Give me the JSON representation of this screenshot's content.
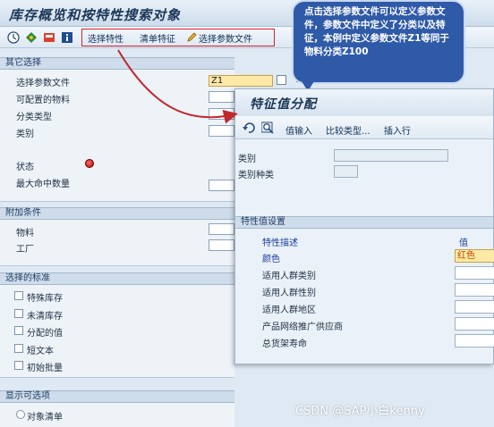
{
  "window": {
    "title": "库存概览和按特性搜索对象"
  },
  "toolbar": {
    "icons": [
      "execute-icon",
      "variant-icon",
      "save-variant-icon",
      "info-icon"
    ],
    "buttons": [
      "选择特性",
      "清单特征",
      "选择参数文件"
    ]
  },
  "callout": {
    "text": "点击选择参数文件可以定义参数文件，参数文件中定义了分类以及特征，本例中定义参数文件Z1等同于物料分类Z100"
  },
  "other_selection": {
    "header": "其它选择",
    "fields": [
      {
        "label": "选择参数文件",
        "value": "Z1",
        "suffix": "Z1"
      },
      {
        "label": "可配置的物料",
        "value": ""
      },
      {
        "label": "分类类型",
        "value": ""
      },
      {
        "label": "类别",
        "value": ""
      }
    ],
    "status_label": "状态",
    "max_hits_label": "最大命中数量"
  },
  "additional": {
    "header": "附加条件",
    "fields": [
      {
        "label": "物料"
      },
      {
        "label": "工厂"
      }
    ]
  },
  "criteria": {
    "header": "选择的标准",
    "checkboxes": [
      "特殊库存",
      "未清库存",
      "分配的值",
      "短文本",
      "初始批量"
    ]
  },
  "display": {
    "header": "显示可选项",
    "radios": [
      "对象清单"
    ]
  },
  "dialog": {
    "title": "特征值分配",
    "toolbar": [
      "值输入",
      "比较类型...",
      "插入行"
    ],
    "class_label": "类别",
    "class_type_label": "类别种类",
    "group_header": "特性值设置",
    "col_desc": "特性描述",
    "col_value": "值",
    "rows": [
      {
        "label": "颜色",
        "value": "红色",
        "highlight": true
      },
      {
        "label": "适用人群类别",
        "value": ""
      },
      {
        "label": "适用人群性别",
        "value": ""
      },
      {
        "label": "适用人群地区",
        "value": ""
      },
      {
        "label": "产品网络推广供应商",
        "value": ""
      },
      {
        "label": "总货架寿命",
        "value": ""
      }
    ]
  },
  "watermark": "CSDN @SAP小白kenny",
  "colors": {
    "callout_bg": "#2f5aa8",
    "highlight_border": "#d8212a",
    "arrow": "#c0282e"
  }
}
